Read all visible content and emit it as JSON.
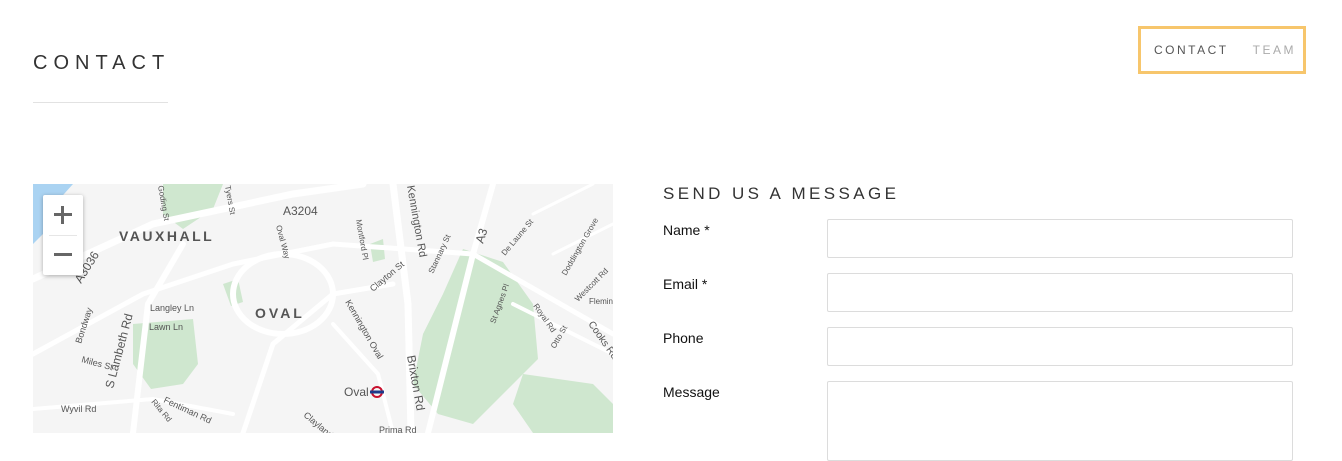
{
  "page": {
    "title": "CONTACT"
  },
  "nav": {
    "items": [
      {
        "label": "CONTACT",
        "active": true
      },
      {
        "label": "TEAM",
        "active": false
      }
    ],
    "highlight_color": "#f7c66c"
  },
  "map": {
    "zoom_in_icon": "plus-icon",
    "zoom_out_icon": "minus-icon",
    "district_labels": [
      "VAUXHALL",
      "OVAL"
    ],
    "station_label": "Oval",
    "road_labels": [
      "A3204",
      "A3036",
      "A3",
      "Kennington Rd",
      "Brixton Rd",
      "S Lambeth Rd",
      "Clayton St",
      "Kennington Oval",
      "Langley Ln",
      "Lawn Ln",
      "Bondway",
      "Miles St",
      "Wyvil Rd",
      "Fentiman Rd",
      "Montford Pl",
      "Oval Way",
      "Stannary St",
      "De Laune St",
      "Doddington Grove",
      "Westcott Rd",
      "St Agnes Pl",
      "Royal Rd",
      "Otto St",
      "Cooks Rd",
      "Goding St",
      "Tyers St",
      "Prima Rd",
      "Clayland Rd",
      "Rita Rd",
      "Fleming Rd"
    ],
    "colors": {
      "park": "#cfe7cf",
      "water": "#aad3f2",
      "road": "#ffffff",
      "station": "#1c93c9"
    }
  },
  "form": {
    "title": "SEND US A MESSAGE",
    "fields": [
      {
        "label": "Name *",
        "value": ""
      },
      {
        "label": "Email *",
        "value": ""
      },
      {
        "label": "Phone",
        "value": ""
      },
      {
        "label": "Message",
        "value": ""
      }
    ]
  }
}
